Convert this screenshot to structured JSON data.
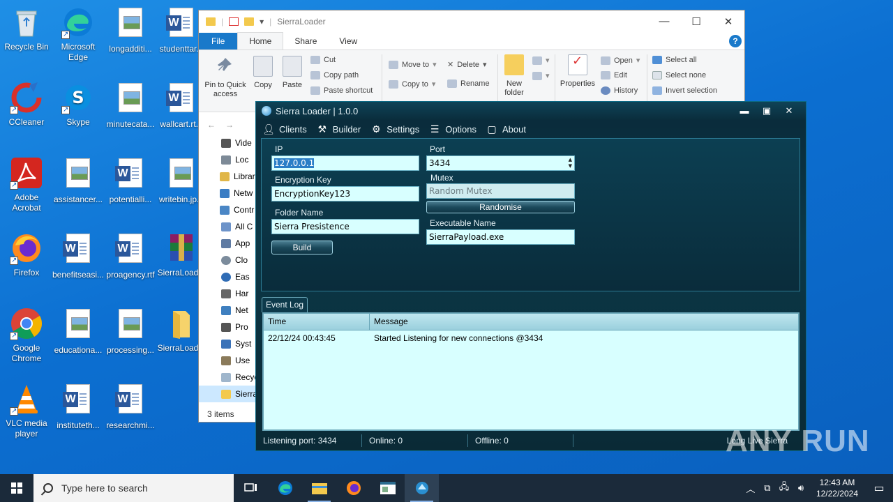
{
  "desktop": {
    "icons": [
      {
        "label": "Recycle Bin"
      },
      {
        "label": "Microsoft Edge"
      },
      {
        "label": "longadditi..."
      },
      {
        "label": "studenttar..."
      },
      {
        "label": "CCleaner"
      },
      {
        "label": "Skype"
      },
      {
        "label": "minutecata..."
      },
      {
        "label": "wallcart.rt..."
      },
      {
        "label": "Adobe Acrobat"
      },
      {
        "label": "assistancer..."
      },
      {
        "label": "potentialli..."
      },
      {
        "label": "writebin.jp..."
      },
      {
        "label": "Firefox"
      },
      {
        "label": "benefitseasi..."
      },
      {
        "label": "proagency.rtf"
      },
      {
        "label": "SierraLoad..."
      },
      {
        "label": "Google Chrome"
      },
      {
        "label": "educationa..."
      },
      {
        "label": "processing..."
      },
      {
        "label": "SierraLoad..."
      },
      {
        "label": "VLC media player"
      },
      {
        "label": "instituteth..."
      },
      {
        "label": "researchmi..."
      }
    ]
  },
  "explorer": {
    "title": "SierraLoader",
    "tabs": [
      "File",
      "Home",
      "Share",
      "View"
    ],
    "ribbon": {
      "pin": "Pin to Quick access",
      "copy": "Copy",
      "paste": "Paste",
      "cut": "Cut",
      "copy_path": "Copy path",
      "paste_shortcut": "Paste shortcut",
      "move_to": "Move to",
      "copy_to": "Copy to",
      "delete": "Delete",
      "rename": "Rename",
      "new_folder": "New folder",
      "properties": "Properties",
      "open": "Open",
      "edit": "Edit",
      "history": "History",
      "select_all": "Select all",
      "select_none": "Select none",
      "invert_selection": "Invert selection"
    },
    "nav_items": [
      "Vide",
      "Loc",
      "Librar",
      "Netw",
      "Contr",
      "All C",
      "App",
      "Clo",
      "Eas",
      "Har",
      "Net",
      "Pro",
      "Syst",
      "Use",
      "Recyc",
      "Sierra"
    ],
    "status": "3 items"
  },
  "sierra": {
    "title": "Sierra Loader | 1.0.0",
    "menu": [
      "Clients",
      "Builder",
      "Settings",
      "Options",
      "About"
    ],
    "fields": {
      "ip_label": "IP",
      "ip_value": "127.0.0.1",
      "port_label": "Port",
      "port_value": "3434",
      "enc_label": "Encryption Key",
      "enc_value": "EncryptionKey123",
      "mutex_label": "Mutex",
      "mutex_placeholder": "Random Mutex",
      "randomise": "Randomise",
      "folder_label": "Folder Name",
      "folder_value": "Sierra Presistence",
      "exe_label": "Executable Name",
      "exe_value": "SierraPayload.exe",
      "build": "Build"
    },
    "event_log": {
      "tab": "Event Log",
      "columns": [
        "Time",
        "Message"
      ],
      "rows": [
        {
          "time": "22/12/24 00:43:45",
          "message": "Started Listening for new connections @3434"
        }
      ]
    },
    "status": {
      "listening": "Listening port: 3434",
      "online": "Online: 0",
      "offline": "Offline: 0",
      "motto": "Long Live Sierra"
    }
  },
  "watermark": "ANY RUN",
  "taskbar": {
    "search_placeholder": "Type here to search",
    "time": "12:43 AM",
    "date": "12/22/2024"
  }
}
